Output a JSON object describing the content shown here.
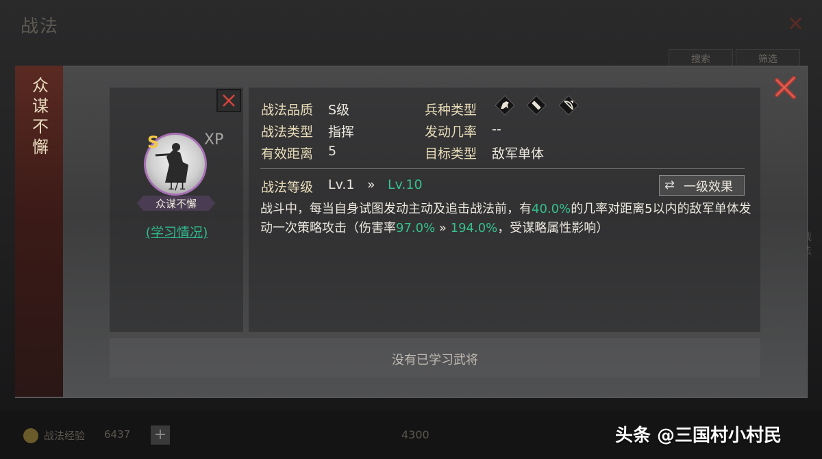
{
  "background": {
    "title": "战法",
    "buttons": [
      "搜索",
      "筛选"
    ],
    "right_text": "战法",
    "bottom": {
      "coin_label": "战法经验",
      "coin_value": "6437",
      "plus": "+",
      "cost": "4300"
    }
  },
  "dialog": {
    "side_title": "众谋不懈",
    "close_icon": "close-x-icon",
    "tactic": {
      "grade": "S",
      "xp": "XP",
      "count": "1/1",
      "name": "众谋不懈",
      "learn_link": "(学习情况)"
    },
    "attributes": {
      "quality_label": "战法品质",
      "quality_value": "S级",
      "type_label": "战法类型",
      "type_value": "指挥",
      "range_label": "有效距离",
      "range_value": "5",
      "troop_label": "兵种类型",
      "troop_icons": [
        "cavalry-icon",
        "shield-icon",
        "bow-icon"
      ],
      "chance_label": "发动几率",
      "chance_value": "--",
      "target_label": "目标类型",
      "target_value": "敌军单体"
    },
    "level": {
      "label": "战法等级",
      "current": "Lv.1",
      "arrow": "»",
      "max": "Lv.10",
      "effect_button": "一级效果",
      "effect_icon": "⇄"
    },
    "description": {
      "p1": "战斗中，每当自身试图发动主动及追击战法前，有",
      "h1": "40.0%",
      "p2": "的几率对距离5以内的敌军单体发动一次策略攻击（伤害率",
      "h2": "97.0%",
      "p3": " » ",
      "h3": "194.0%",
      "p4": "，受谋略属性影响）"
    },
    "no_general": "没有已学习武将"
  },
  "watermark": "头条 @三国村小村民",
  "colors": {
    "accent_green": "#36c08c",
    "label_gold": "#e9ddb8",
    "close_red": "#c0392b",
    "grade_gold": "#f2c84a"
  }
}
